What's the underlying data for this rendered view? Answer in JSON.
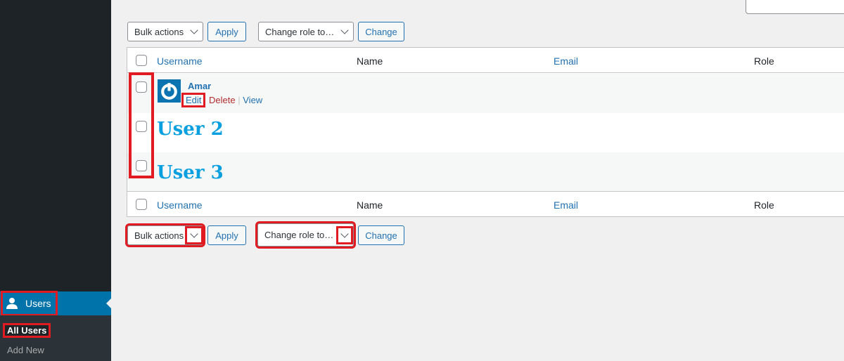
{
  "sidebar": {
    "users": "Users",
    "all_users": "All Users",
    "add_new": "Add New"
  },
  "toolbar": {
    "bulk_actions": "Bulk actions",
    "apply": "Apply",
    "change_role": "Change role to…",
    "change": "Change"
  },
  "table": {
    "columns": [
      "Username",
      "Name",
      "Email",
      "Role"
    ],
    "rows": [
      {
        "username": "Amar",
        "actions": {
          "edit": "Edit",
          "delete": "Delete",
          "view": "View"
        }
      },
      {
        "username": "User 2"
      },
      {
        "username": "User 3"
      }
    ]
  },
  "colors": {
    "accent": "#2271b1",
    "menu_active": "#0073aa",
    "highlight": "#e01b22"
  }
}
